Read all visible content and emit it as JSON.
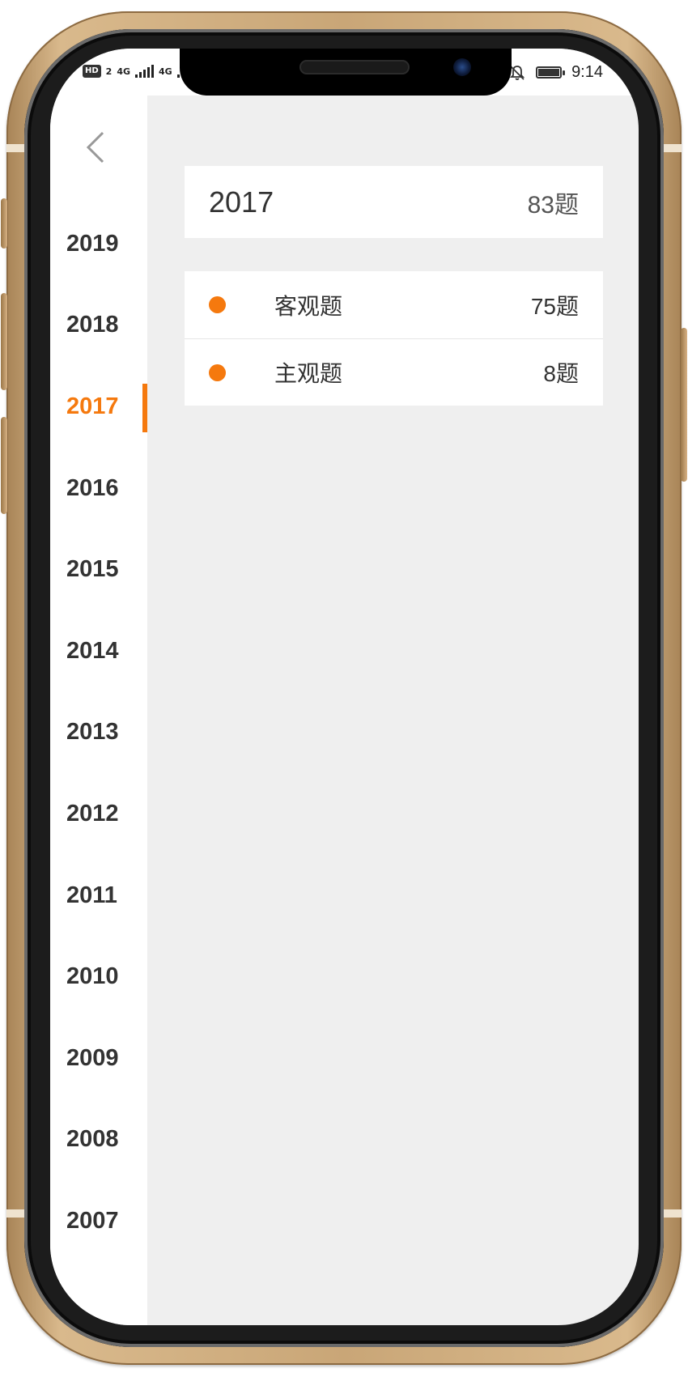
{
  "status_bar": {
    "hd": "HD",
    "hd_sub": "2",
    "network_1": "4G",
    "network_2": "4G",
    "time": "9:14",
    "icons": [
      "hd-icon",
      "signal-icon",
      "signal-icon",
      "bell-off-icon",
      "battery-icon"
    ]
  },
  "sidebar": {
    "back_icon": "chevron-left-icon",
    "years": [
      "2019",
      "2018",
      "2017",
      "2016",
      "2015",
      "2014",
      "2013",
      "2012",
      "2011",
      "2010",
      "2009",
      "2008",
      "2007"
    ],
    "active_year": "2017"
  },
  "summary": {
    "year": "2017",
    "count": "83题"
  },
  "question_types": [
    {
      "label": "客观题",
      "count": "75题"
    },
    {
      "label": "主观题",
      "count": "8题"
    }
  ],
  "colors": {
    "accent": "#f5790e",
    "text": "#333333",
    "background": "#efefef"
  }
}
